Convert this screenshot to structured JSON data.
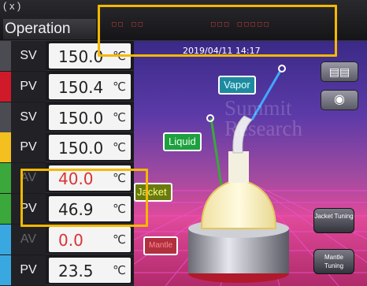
{
  "header": {
    "title": "Operation",
    "top_partial": "( x )",
    "red_text_1": "□□ □□",
    "red_text_2": "□□□ □□□□□"
  },
  "rows": [
    {
      "label": "SV",
      "value": "150.0",
      "unit": "℃",
      "bar_color": "#4b4b52",
      "val_color": "#222"
    },
    {
      "label": "PV",
      "value": "150.4",
      "unit": "℃",
      "bar_color": "#d01a2a",
      "val_color": "#222"
    },
    {
      "label": "SV",
      "value": "150.0",
      "unit": "℃",
      "bar_color": "#4b4b52",
      "val_color": "#222"
    },
    {
      "label": "PV",
      "value": "150.0",
      "unit": "℃",
      "bar_color": "#f4c020",
      "val_color": "#222"
    },
    {
      "label": "AV",
      "value": "40.0",
      "unit": "℃",
      "bar_color": "#3aa83a",
      "val_color": "#d83434"
    },
    {
      "label": "PV",
      "value": "46.9",
      "unit": "℃",
      "bar_color": "#3aa83a",
      "val_color": "#222"
    },
    {
      "label": "AV",
      "value": "0.0",
      "unit": "℃",
      "bar_color": "#3aa8e0",
      "val_color": "#d83434"
    },
    {
      "label": "PV",
      "value": "23.5",
      "unit": "℃",
      "bar_color": "#3aa8e0",
      "val_color": "#222"
    }
  ],
  "scene": {
    "datetime": "2019/04/11 14:17",
    "watermark_1": "Summit",
    "watermark_2": "Research",
    "vapor_label": "Vapor",
    "liquid_label": "Liquid",
    "jacket_label": "Jacket",
    "mantle_label": "Mantle",
    "jacket_tuning": "Jacket Tuning",
    "mantle_tuning": "Mantle Tuning"
  },
  "colors": {
    "highlight": "#f5b800",
    "grid_line": "#e040c0"
  },
  "icons": {
    "chart": "bar-chart-icon",
    "camera": "camera-icon"
  }
}
